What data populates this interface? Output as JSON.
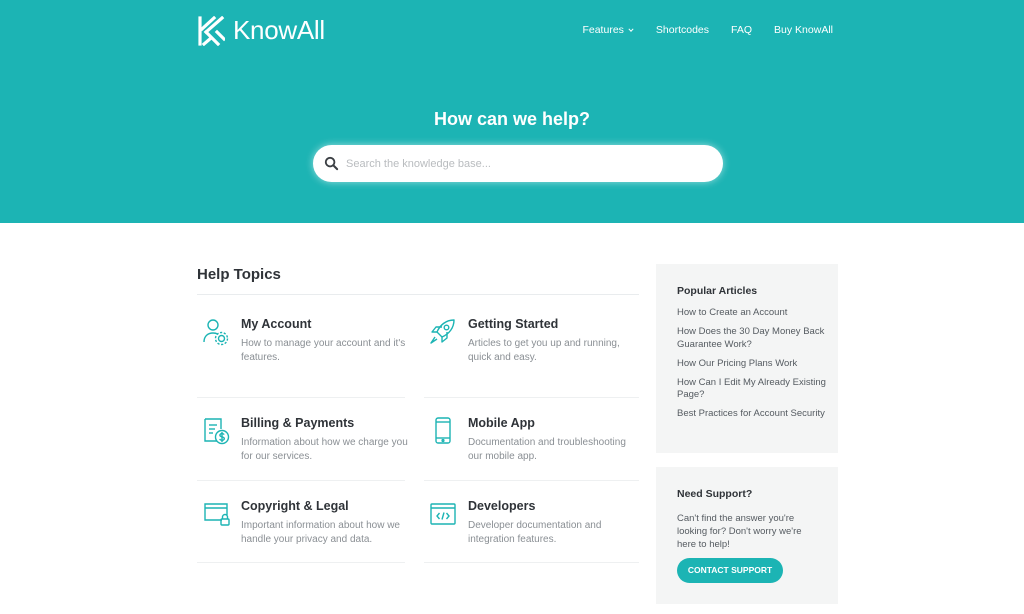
{
  "brand": {
    "name": "KnowAll",
    "logo_icon": "knowall-logo-mark",
    "accent": "#1cb4b4"
  },
  "nav": {
    "items": [
      {
        "label": "Features",
        "has_dropdown": true
      },
      {
        "label": "Shortcodes"
      },
      {
        "label": "FAQ"
      },
      {
        "label": "Buy KnowAll"
      }
    ]
  },
  "hero": {
    "title": "How can we help?",
    "search": {
      "placeholder": "Search the knowledge base...",
      "value": "",
      "icon": "search-icon"
    }
  },
  "help_topics": {
    "title": "Help Topics",
    "items": [
      {
        "title": "My Account",
        "description": "How to manage your account and it's features.",
        "icon": "account-gear-icon"
      },
      {
        "title": "Getting Started",
        "description": "Articles to get you up and running, quick and easy.",
        "icon": "rocket-icon"
      },
      {
        "title": "Billing & Payments",
        "description": "Information about how we charge you for our services.",
        "icon": "billing-dollar-icon"
      },
      {
        "title": "Mobile App",
        "description": "Documentation and troubleshooting our mobile app.",
        "icon": "mobile-phone-icon"
      },
      {
        "title": "Copyright & Legal",
        "description": "Important information about how we handle your privacy and data.",
        "icon": "legal-lock-icon"
      },
      {
        "title": "Developers",
        "description": "Developer documentation and integration features.",
        "icon": "code-window-icon"
      }
    ]
  },
  "popular_articles": {
    "title": "Popular Articles",
    "items": [
      "How to Create an Account",
      "How Does the 30 Day Money Back Guarantee Work?",
      "How Our Pricing Plans Work",
      "How Can I Edit My Already Existing Page?",
      "Best Practices for Account Security"
    ]
  },
  "support": {
    "title": "Need Support?",
    "text": "Can't find the answer you're looking for? Don't worry we're here to help!",
    "button_label": "CONTACT SUPPORT"
  }
}
